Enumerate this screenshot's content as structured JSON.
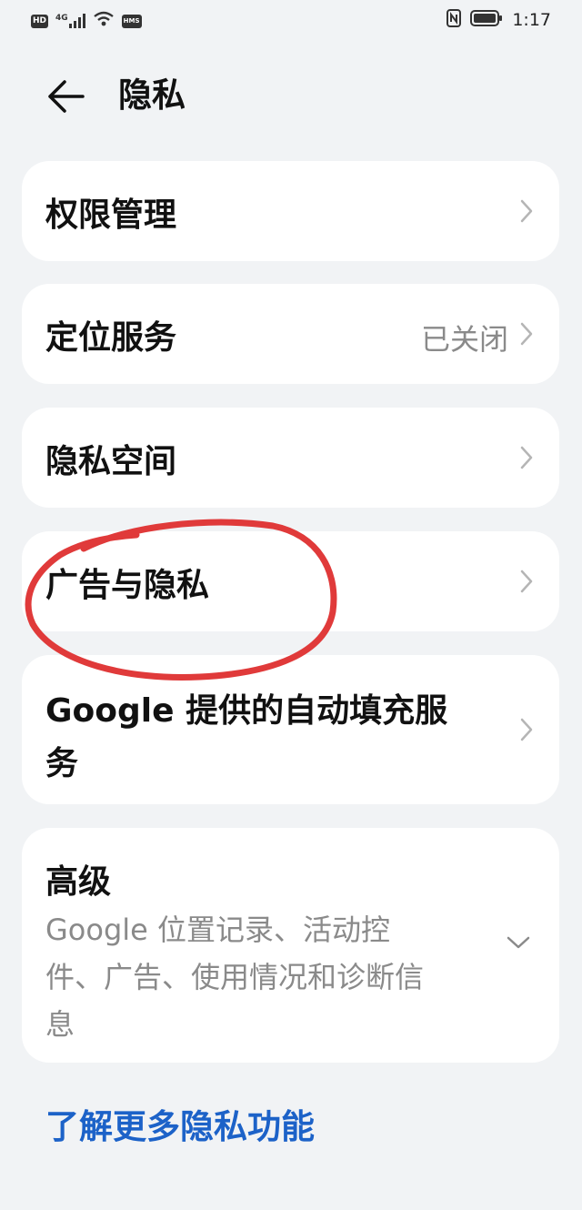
{
  "status_bar": {
    "hd_badge": "HD",
    "network": "4G",
    "hms_badge": "HMS",
    "time": "1:17",
    "icons": [
      "signal-icon",
      "wifi-icon",
      "nfc-icon",
      "battery-icon"
    ]
  },
  "header": {
    "title": "隐私",
    "back_icon": "back-arrow-icon"
  },
  "items": [
    {
      "label": "权限管理",
      "value": ""
    },
    {
      "label": "定位服务",
      "value": "已关闭"
    },
    {
      "label": "隐私空间",
      "value": ""
    },
    {
      "label": "广告与隐私",
      "value": ""
    },
    {
      "label_line1": "Google 提供的自动填充服",
      "label_line2": "务"
    }
  ],
  "advanced": {
    "title": "高级",
    "desc_line1": "Google 位置记录、活动控",
    "desc_line2": "件、广告、使用情况和诊断信",
    "desc_line3": "息",
    "icon": "chevron-down-icon"
  },
  "learn_more": "了解更多隐私功能",
  "colors": {
    "background": "#f1f3f5",
    "card": "#ffffff",
    "link": "#1c62c8",
    "annotation": "#e03a3a",
    "secondary_text": "#8a8a8a"
  }
}
